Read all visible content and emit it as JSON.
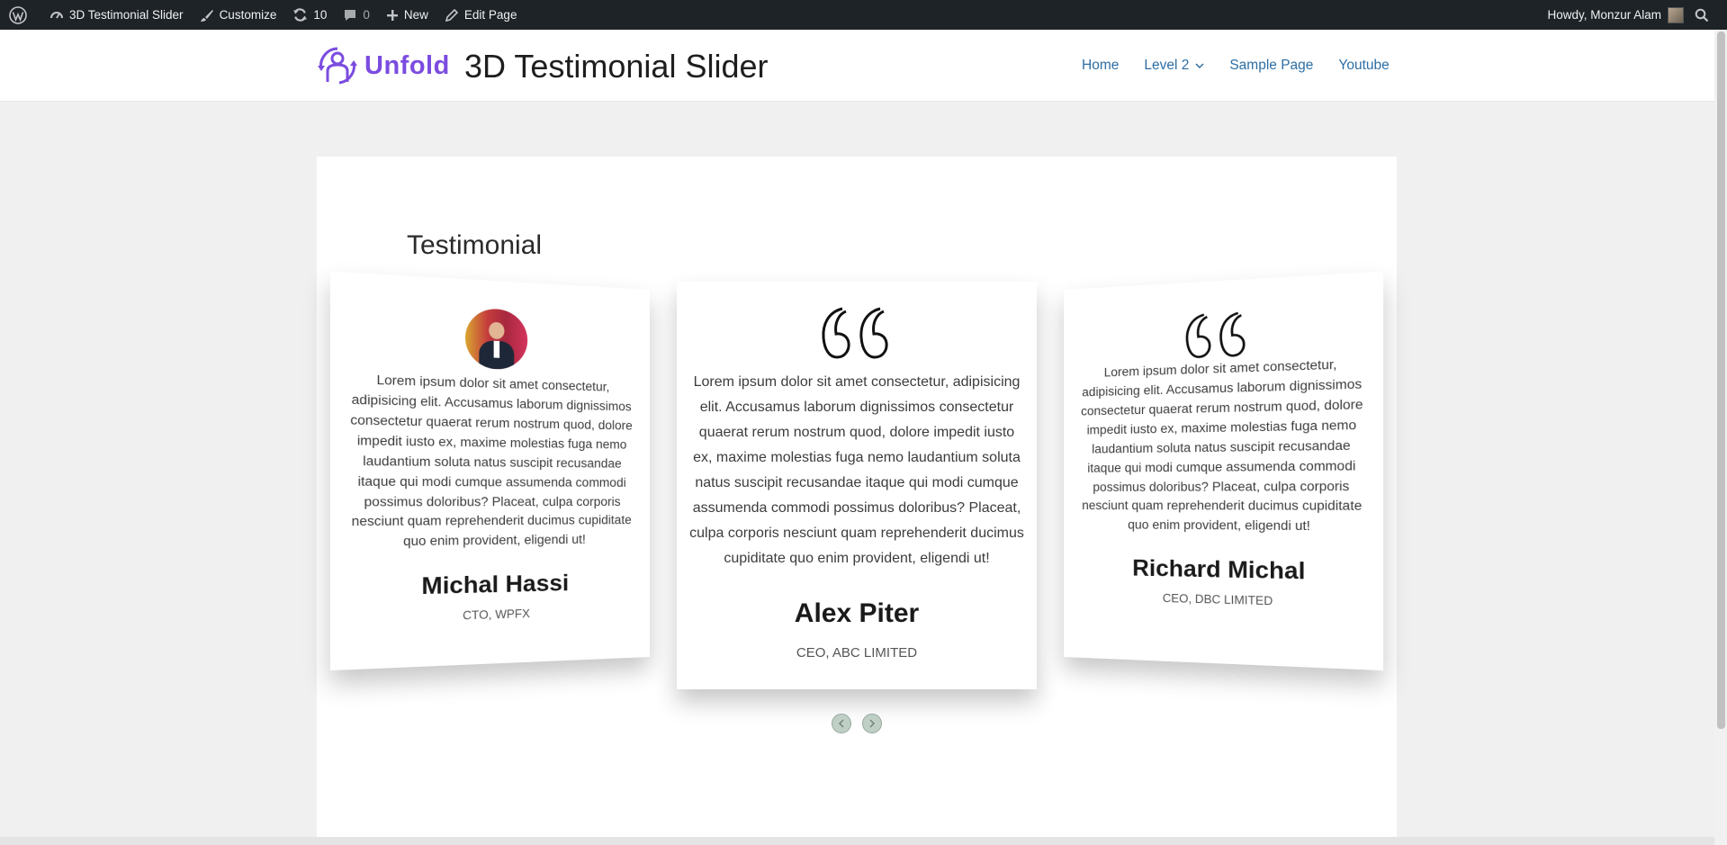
{
  "admin_bar": {
    "site_name": "3D Testimonial Slider",
    "customize": "Customize",
    "updates_count": "10",
    "comments_count": "0",
    "new": "New",
    "edit_page": "Edit Page",
    "greeting": "Howdy, Monzur Alam"
  },
  "header": {
    "logo_text": "Unfold",
    "site_title": "3D Testimonial Slider",
    "nav": [
      "Home",
      "Level 2",
      "Sample Page",
      "Youtube"
    ]
  },
  "main": {
    "section_title": "Testimonial",
    "testimonials": [
      {
        "text": "Lorem ipsum dolor sit amet consectetur, adipisicing elit. Accusamus laborum dignissimos consectetur quaerat rerum nostrum quod, dolore impedit iusto ex, maxime molestias fuga nemo laudantium soluta natus suscipit recusandae itaque qui modi cumque assumenda commodi possimus doloribus? Placeat, culpa corporis nesciunt quam reprehenderit ducimus cupiditate quo enim provident, eligendi ut!",
        "name": "Michal Hassi",
        "role": "CTO, WPFX"
      },
      {
        "text": "Lorem ipsum dolor sit amet consectetur, adipisicing elit. Accusamus laborum dignissimos consectetur quaerat rerum nostrum quod, dolore impedit iusto ex, maxime molestias fuga nemo laudantium soluta natus suscipit recusandae itaque qui modi cumque assumenda commodi possimus doloribus? Placeat, culpa corporis nesciunt quam reprehenderit ducimus cupiditate quo enim provident, eligendi ut!",
        "name": "Alex Piter",
        "role": "CEO, ABC LIMITED"
      },
      {
        "text": "Lorem ipsum dolor sit amet consectetur, adipisicing elit. Accusamus laborum dignissimos consectetur quaerat rerum nostrum quod, dolore impedit iusto ex, maxime molestias fuga nemo laudantium soluta natus suscipit recusandae itaque qui modi cumque assumenda commodi possimus doloribus? Placeat, culpa corporis nesciunt quam reprehenderit ducimus cupiditate quo enim provident, eligendi ut!",
        "name": "Richard Michal",
        "role": "CEO, DBC LIMITED"
      }
    ]
  },
  "icons": {
    "wordpress": "wordpress-icon",
    "dashboard": "dashboard-icon",
    "customize": "brush-icon",
    "updates": "refresh-icon",
    "comments": "comment-icon",
    "new": "plus-icon",
    "edit": "pencil-icon",
    "search": "search-icon",
    "quote": "quote-icon"
  },
  "colors": {
    "admin_bar_bg": "#1d2327",
    "brand_purple": "#7b4ce0",
    "nav_link": "#2d6ea4",
    "page_bg": "#f0f0f1"
  }
}
